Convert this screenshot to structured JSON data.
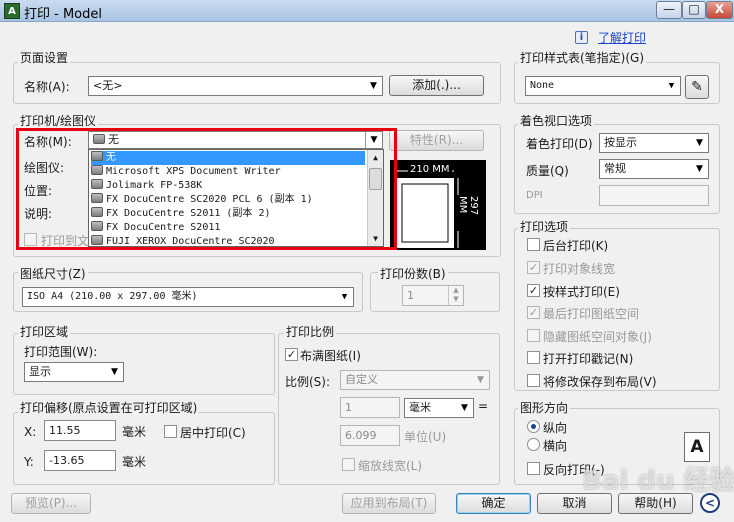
{
  "window": {
    "title": "打印 - Model",
    "app_icon": "A",
    "minimize": "—",
    "maximize": "□",
    "close": "X"
  },
  "help": {
    "info_icon": "i",
    "link": "了解打印"
  },
  "page_setup": {
    "group_label": "页面设置",
    "name_label": "名称(A):",
    "name_value": "<无>",
    "add_button": "添加(.)..."
  },
  "printer": {
    "group_label": "打印机/绘图仪",
    "name_label": "名称(M):",
    "name_value": "无",
    "properties_button": "特性(R)...",
    "plotter_label": "绘图仪:",
    "location_label": "位置:",
    "description_label": "说明:",
    "print_to_file": "打印到文",
    "paper_width": "210 MM",
    "paper_height": "297 MM",
    "options": [
      "无",
      "Microsoft XPS Document Writer",
      "Jolimark FP-538K",
      "FX DocuCentre SC2020 PCL 6 (副本 1)",
      "FX DocuCentre S2011 (副本 2)",
      "FX DocuCentre S2011",
      "FUJI XEROX DocuCentre SC2020"
    ],
    "selected_index": 0
  },
  "paper_size": {
    "group_label": "图纸尺寸(Z)",
    "value": "ISO A4 (210.00 x 297.00 毫米)"
  },
  "copies": {
    "group_label": "打印份数(B)",
    "value": "1"
  },
  "plot_area": {
    "group_label": "打印区域",
    "range_label": "打印范围(W):",
    "range_value": "显示"
  },
  "plot_scale": {
    "group_label": "打印比例",
    "fit_to_paper": "布满图纸(I)",
    "fit_checked": true,
    "scale_label": "比例(S):",
    "scale_value": "自定义",
    "value1": "1",
    "unit": "毫米",
    "equals": "=",
    "value2": "6.099",
    "unit2": "单位(U)",
    "scale_lineweights": "缩放线宽(L)"
  },
  "plot_offset": {
    "group_label": "打印偏移(原点设置在可打印区域)",
    "x_label": "X:",
    "x_value": "11.55",
    "x_unit": "毫米",
    "center_plot": "居中打印(C)",
    "y_label": "Y:",
    "y_value": "-13.65",
    "y_unit": "毫米"
  },
  "plot_style": {
    "group_label": "打印样式表(笔指定)(G)",
    "value": "None"
  },
  "shaded_viewport": {
    "group_label": "着色视口选项",
    "shade_label": "着色打印(D)",
    "shade_value": "按显示",
    "quality_label": "质量(Q)",
    "quality_value": "常规",
    "dpi_label": "DPI"
  },
  "plot_options": {
    "group_label": "打印选项",
    "items": [
      {
        "label": "后台打印(K)",
        "checked": false,
        "enabled": true
      },
      {
        "label": "打印对象线宽",
        "checked": true,
        "enabled": false
      },
      {
        "label": "按样式打印(E)",
        "checked": true,
        "enabled": true
      },
      {
        "label": "最后打印图纸空间",
        "checked": true,
        "enabled": false
      },
      {
        "label": "隐藏图纸空间对象(J)",
        "checked": false,
        "enabled": false
      },
      {
        "label": "打开打印戳记(N)",
        "checked": false,
        "enabled": true
      },
      {
        "label": "将修改保存到布局(V)",
        "checked": false,
        "enabled": true
      }
    ]
  },
  "orientation": {
    "group_label": "图形方向",
    "portrait": "纵向",
    "landscape": "横向",
    "upside_down": "反向打印(-)",
    "preview_letter": "A",
    "selected": "portrait"
  },
  "footer": {
    "preview": "预览(P)...",
    "apply": "应用到布局(T)",
    "ok": "确定",
    "cancel": "取消",
    "help": "帮助(H)",
    "more": "<"
  },
  "watermark": "Bai du 经验"
}
